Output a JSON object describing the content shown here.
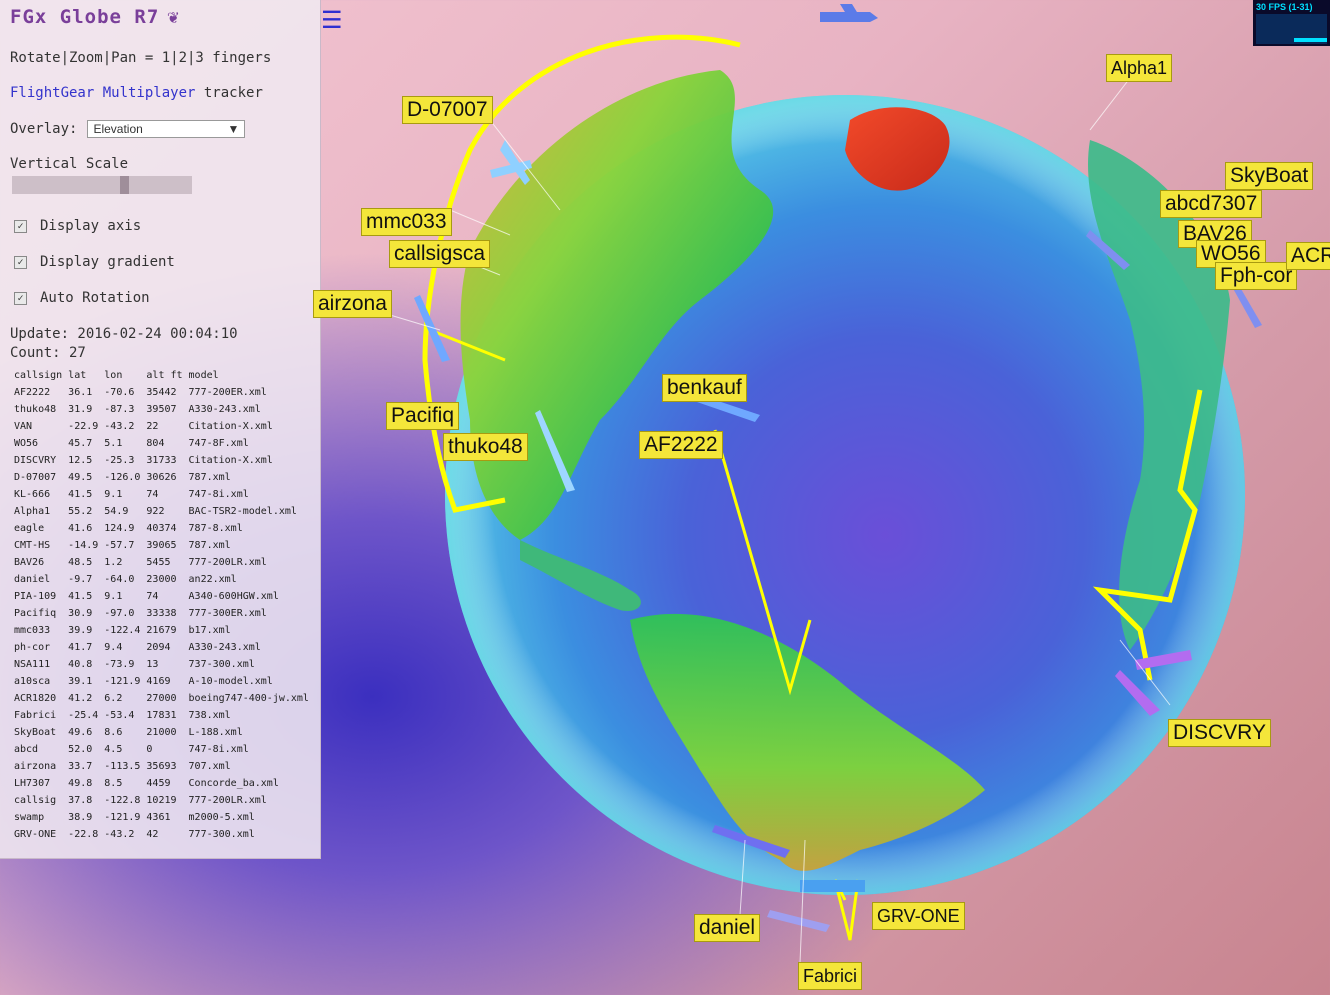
{
  "app": {
    "title": "FGx Globe R7",
    "hint": "Rotate|Zoom|Pan = 1|2|3 fingers",
    "tracker_link": "FlightGear Multiplayer",
    "tracker_suffix": "tracker",
    "overlay_label": "Overlay:",
    "overlay_value": "Elevation",
    "vertical_scale_label": "Vertical Scale",
    "vertical_scale_level": 0.63,
    "checkboxes": [
      {
        "label": "Display axis",
        "checked": true
      },
      {
        "label": "Display gradient",
        "checked": true
      },
      {
        "label": "Auto Rotation",
        "checked": true
      }
    ],
    "update": "Update: 2016-02-24 00:04:10",
    "count": "Count: 27",
    "fps": "30 FPS (1-31)"
  },
  "table": {
    "headers": [
      "callsign",
      "lat",
      "lon",
      "alt ft",
      "model"
    ],
    "rows": [
      [
        "AF2222",
        "36.1",
        "-70.6",
        "35442",
        "777-200ER.xml"
      ],
      [
        "thuko48",
        "31.9",
        "-87.3",
        "39507",
        "A330-243.xml"
      ],
      [
        "VAN",
        "-22.9",
        "-43.2",
        "22",
        "Citation-X.xml"
      ],
      [
        "WO56",
        "45.7",
        "5.1",
        "804",
        "747-8F.xml"
      ],
      [
        "DISCVRY",
        "12.5",
        "-25.3",
        "31733",
        "Citation-X.xml"
      ],
      [
        "D-07007",
        "49.5",
        "-126.0",
        "30626",
        "787.xml"
      ],
      [
        "KL-666",
        "41.5",
        "9.1",
        "74",
        "747-8i.xml"
      ],
      [
        "Alpha1",
        "55.2",
        "54.9",
        "922",
        "BAC-TSR2-model.xml"
      ],
      [
        "eagle",
        "41.6",
        "124.9",
        "40374",
        "787-8.xml"
      ],
      [
        "CMT-HS",
        "-14.9",
        "-57.7",
        "39065",
        "787.xml"
      ],
      [
        "BAV26",
        "48.5",
        "1.2",
        "5455",
        "777-200LR.xml"
      ],
      [
        "daniel",
        "-9.7",
        "-64.0",
        "23000",
        "an22.xml"
      ],
      [
        "PIA-109",
        "41.5",
        "9.1",
        "74",
        "A340-600HGW.xml"
      ],
      [
        "Pacifiq",
        "30.9",
        "-97.0",
        "33338",
        "777-300ER.xml"
      ],
      [
        "mmc033",
        "39.9",
        "-122.4",
        "21679",
        "b17.xml"
      ],
      [
        "ph-cor",
        "41.7",
        "9.4",
        "2094",
        "A330-243.xml"
      ],
      [
        "NSA111",
        "40.8",
        "-73.9",
        "13",
        "737-300.xml"
      ],
      [
        "a10sca",
        "39.1",
        "-121.9",
        "4169",
        "A-10-model.xml"
      ],
      [
        "ACR1820",
        "41.2",
        "6.2",
        "27000",
        "boeing747-400-jw.xml"
      ],
      [
        "Fabrici",
        "-25.4",
        "-53.4",
        "17831",
        "738.xml"
      ],
      [
        "SkyBoat",
        "49.6",
        "8.6",
        "21000",
        "L-188.xml"
      ],
      [
        "abcd",
        "52.0",
        "4.5",
        "0",
        "747-8i.xml"
      ],
      [
        "airzona",
        "33.7",
        "-113.5",
        "35693",
        "707.xml"
      ],
      [
        "LH7307",
        "49.8",
        "8.5",
        "4459",
        "Concorde_ba.xml"
      ],
      [
        "callsig",
        "37.8",
        "-122.8",
        "10219",
        "777-200LR.xml"
      ],
      [
        "swamp",
        "38.9",
        "-121.9",
        "4361",
        "m2000-5.xml"
      ],
      [
        "GRV-ONE",
        "-22.8",
        "-43.2",
        "42",
        "777-300.xml"
      ]
    ]
  },
  "labels": {
    "d07007": "D-07007",
    "mmc033": "mmc033",
    "callsig": "callsigsca",
    "airzona": "airzona",
    "pacifiq": "Pacifiq",
    "thuko48": "thuko48",
    "benkauf": "benkauf",
    "af2222": "AF2222",
    "alpha1": "Alpha1",
    "skyboat": "SkyBoat",
    "abcd": "abcd7307",
    "bav26": "BAV26",
    "wo56": "WO56",
    "phcor": "Fph-cor",
    "acr": "ACR",
    "discvry": "DISCVRY",
    "daniel": "daniel",
    "grvone": "GRV-ONE",
    "fabrici": "Fabrici"
  },
  "colors": {
    "label_bg": "#f4e63a",
    "track": "#ffff00",
    "accent": "#7a3f9a",
    "link": "#3333cc"
  }
}
